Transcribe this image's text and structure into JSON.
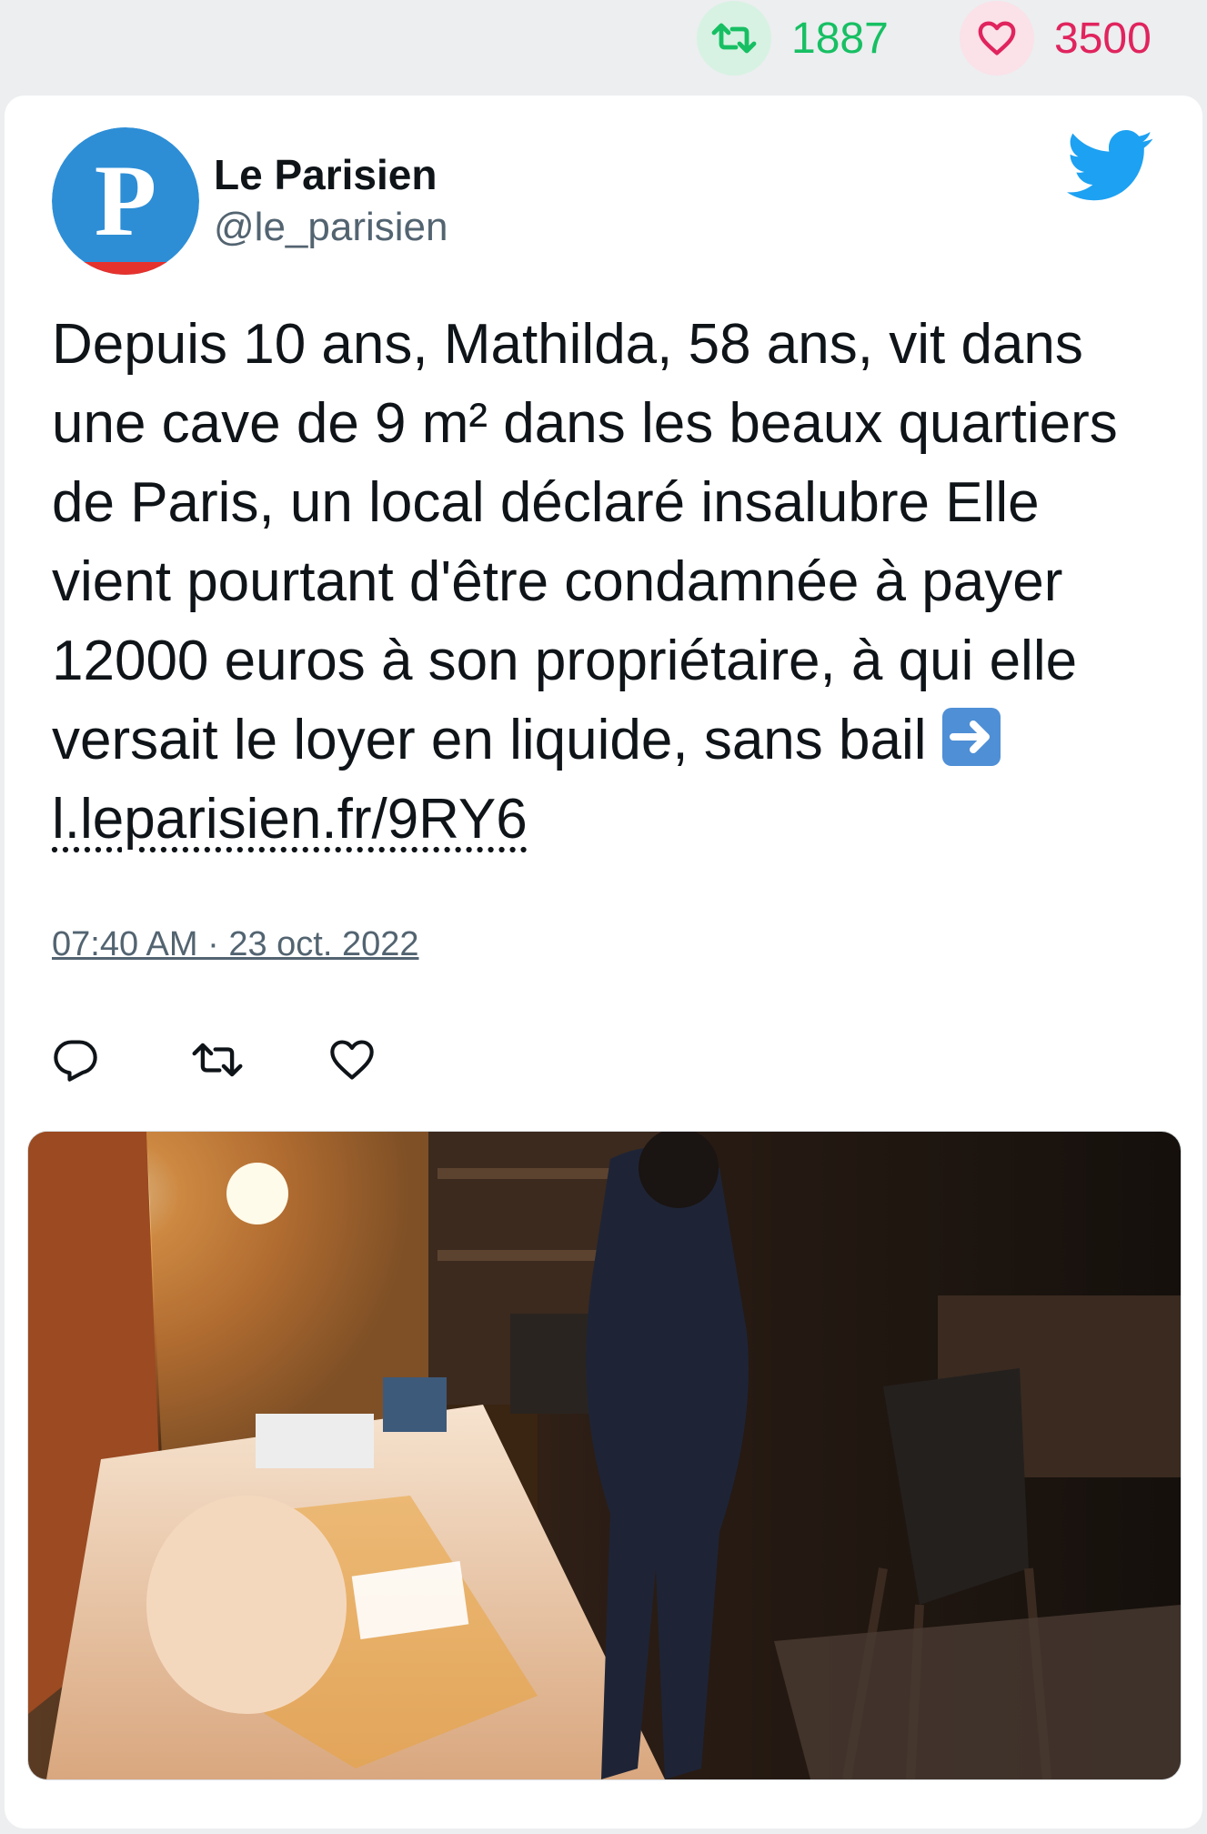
{
  "stats": {
    "retweets": "1887",
    "likes": "3500"
  },
  "tweet": {
    "author_name": "Le Parisien",
    "author_handle": "@le_parisien",
    "avatar_letter": "P",
    "text": "Depuis 10 ans, Mathilda, 58 ans, vit dans une cave de 9 m² dans les beaux quartiers de Paris, un local déclaré insalubre Elle vient pourtant d'être condamnée à payer 12000 euros à son propriétaire, à qui elle versait le loyer en liquide, sans bail",
    "link": "l.leparisien.fr/9RY6",
    "timestamp": "07:40 AM · 23 oct. 2022"
  },
  "icons": {
    "retweet": "retweet-icon",
    "like": "heart-icon",
    "reply": "reply-icon",
    "brand": "twitter-bird-icon",
    "link_arrow": "right-arrow-emoji-icon"
  },
  "colors": {
    "retweet_green": "#17BF63",
    "like_red": "#E0245E",
    "twitter_blue": "#1DA1F2",
    "avatar_blue": "#2D8ED6",
    "avatar_red": "#E5322D"
  }
}
